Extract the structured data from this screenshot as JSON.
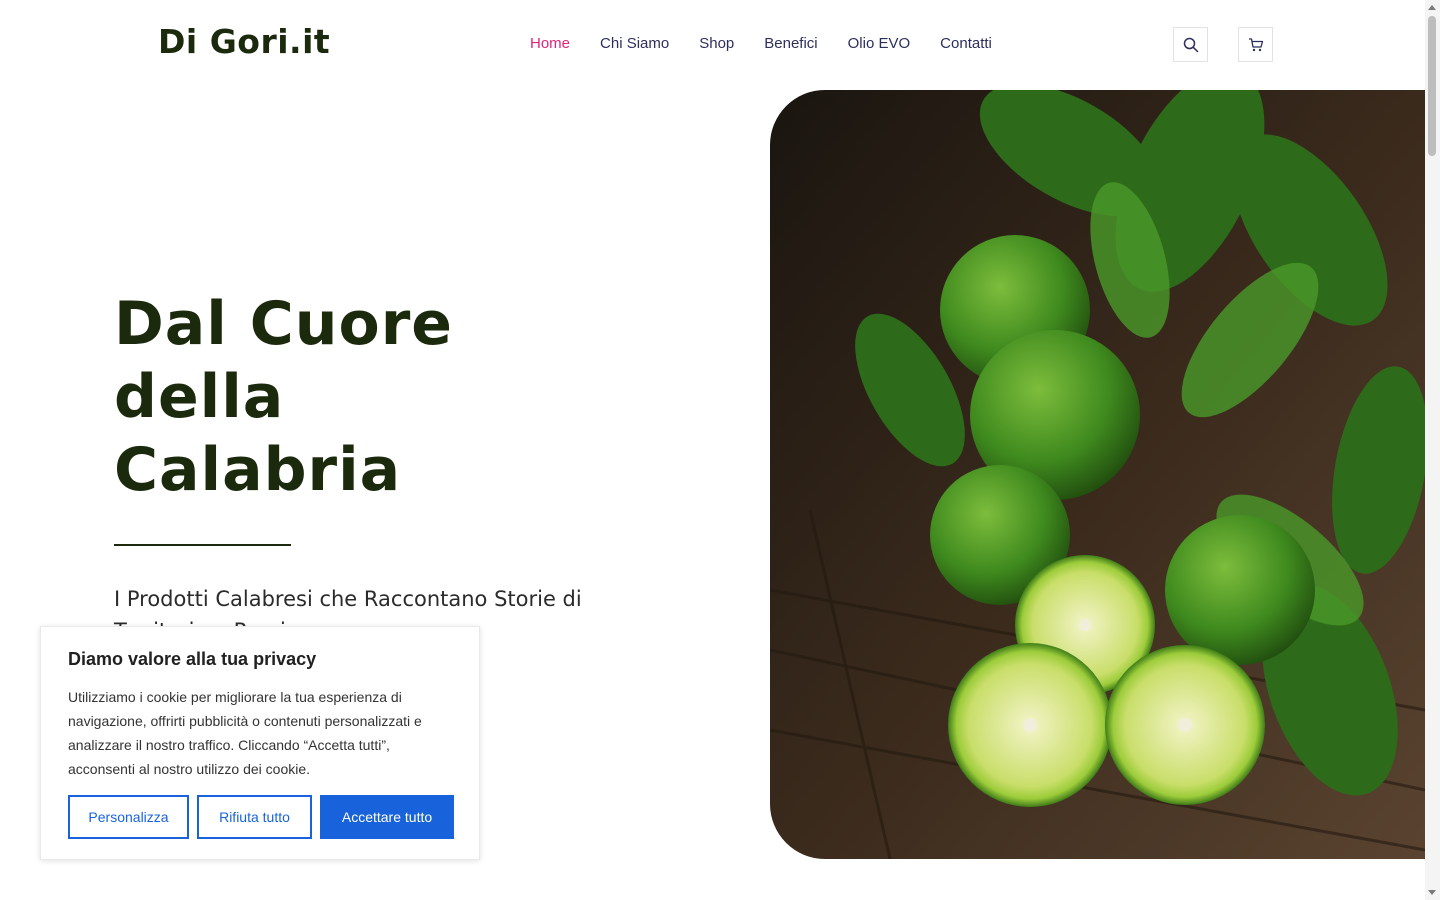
{
  "header": {
    "logo": "Di Gori.it",
    "nav": [
      {
        "label": "Home",
        "active": true
      },
      {
        "label": "Chi Siamo"
      },
      {
        "label": "Shop"
      },
      {
        "label": "Benefici"
      },
      {
        "label": "Olio EVO"
      },
      {
        "label": "Contatti"
      }
    ],
    "icons": {
      "search": "search-icon",
      "cart": "cart-icon"
    }
  },
  "hero": {
    "title_lines": [
      "Dal Cuore",
      "della",
      "Calabria"
    ],
    "subtitle": "I Prodotti Calabresi che Raccontano Storie di Territorio e Passione",
    "image_subject": "bergamotti"
  },
  "cookie_banner": {
    "title": "Diamo valore alla tua privacy",
    "text": "Utilizziamo i cookie per migliorare la tua esperienza di navigazione, offrirti pubblicità o contenuti personalizzati e analizzare il nostro traffico. Cliccando “Accetta tutti”, acconsenti al nostro utilizzo dei cookie.",
    "buttons": {
      "customize": "Personalizza",
      "reject": "Rifiuta tutto",
      "accept": "Accettare tutto"
    }
  },
  "colors": {
    "brand_dark_green": "#1b2a0c",
    "nav_text": "#2c2f5c",
    "nav_active": "#e0267a",
    "cookie_blue": "#1863dc"
  }
}
